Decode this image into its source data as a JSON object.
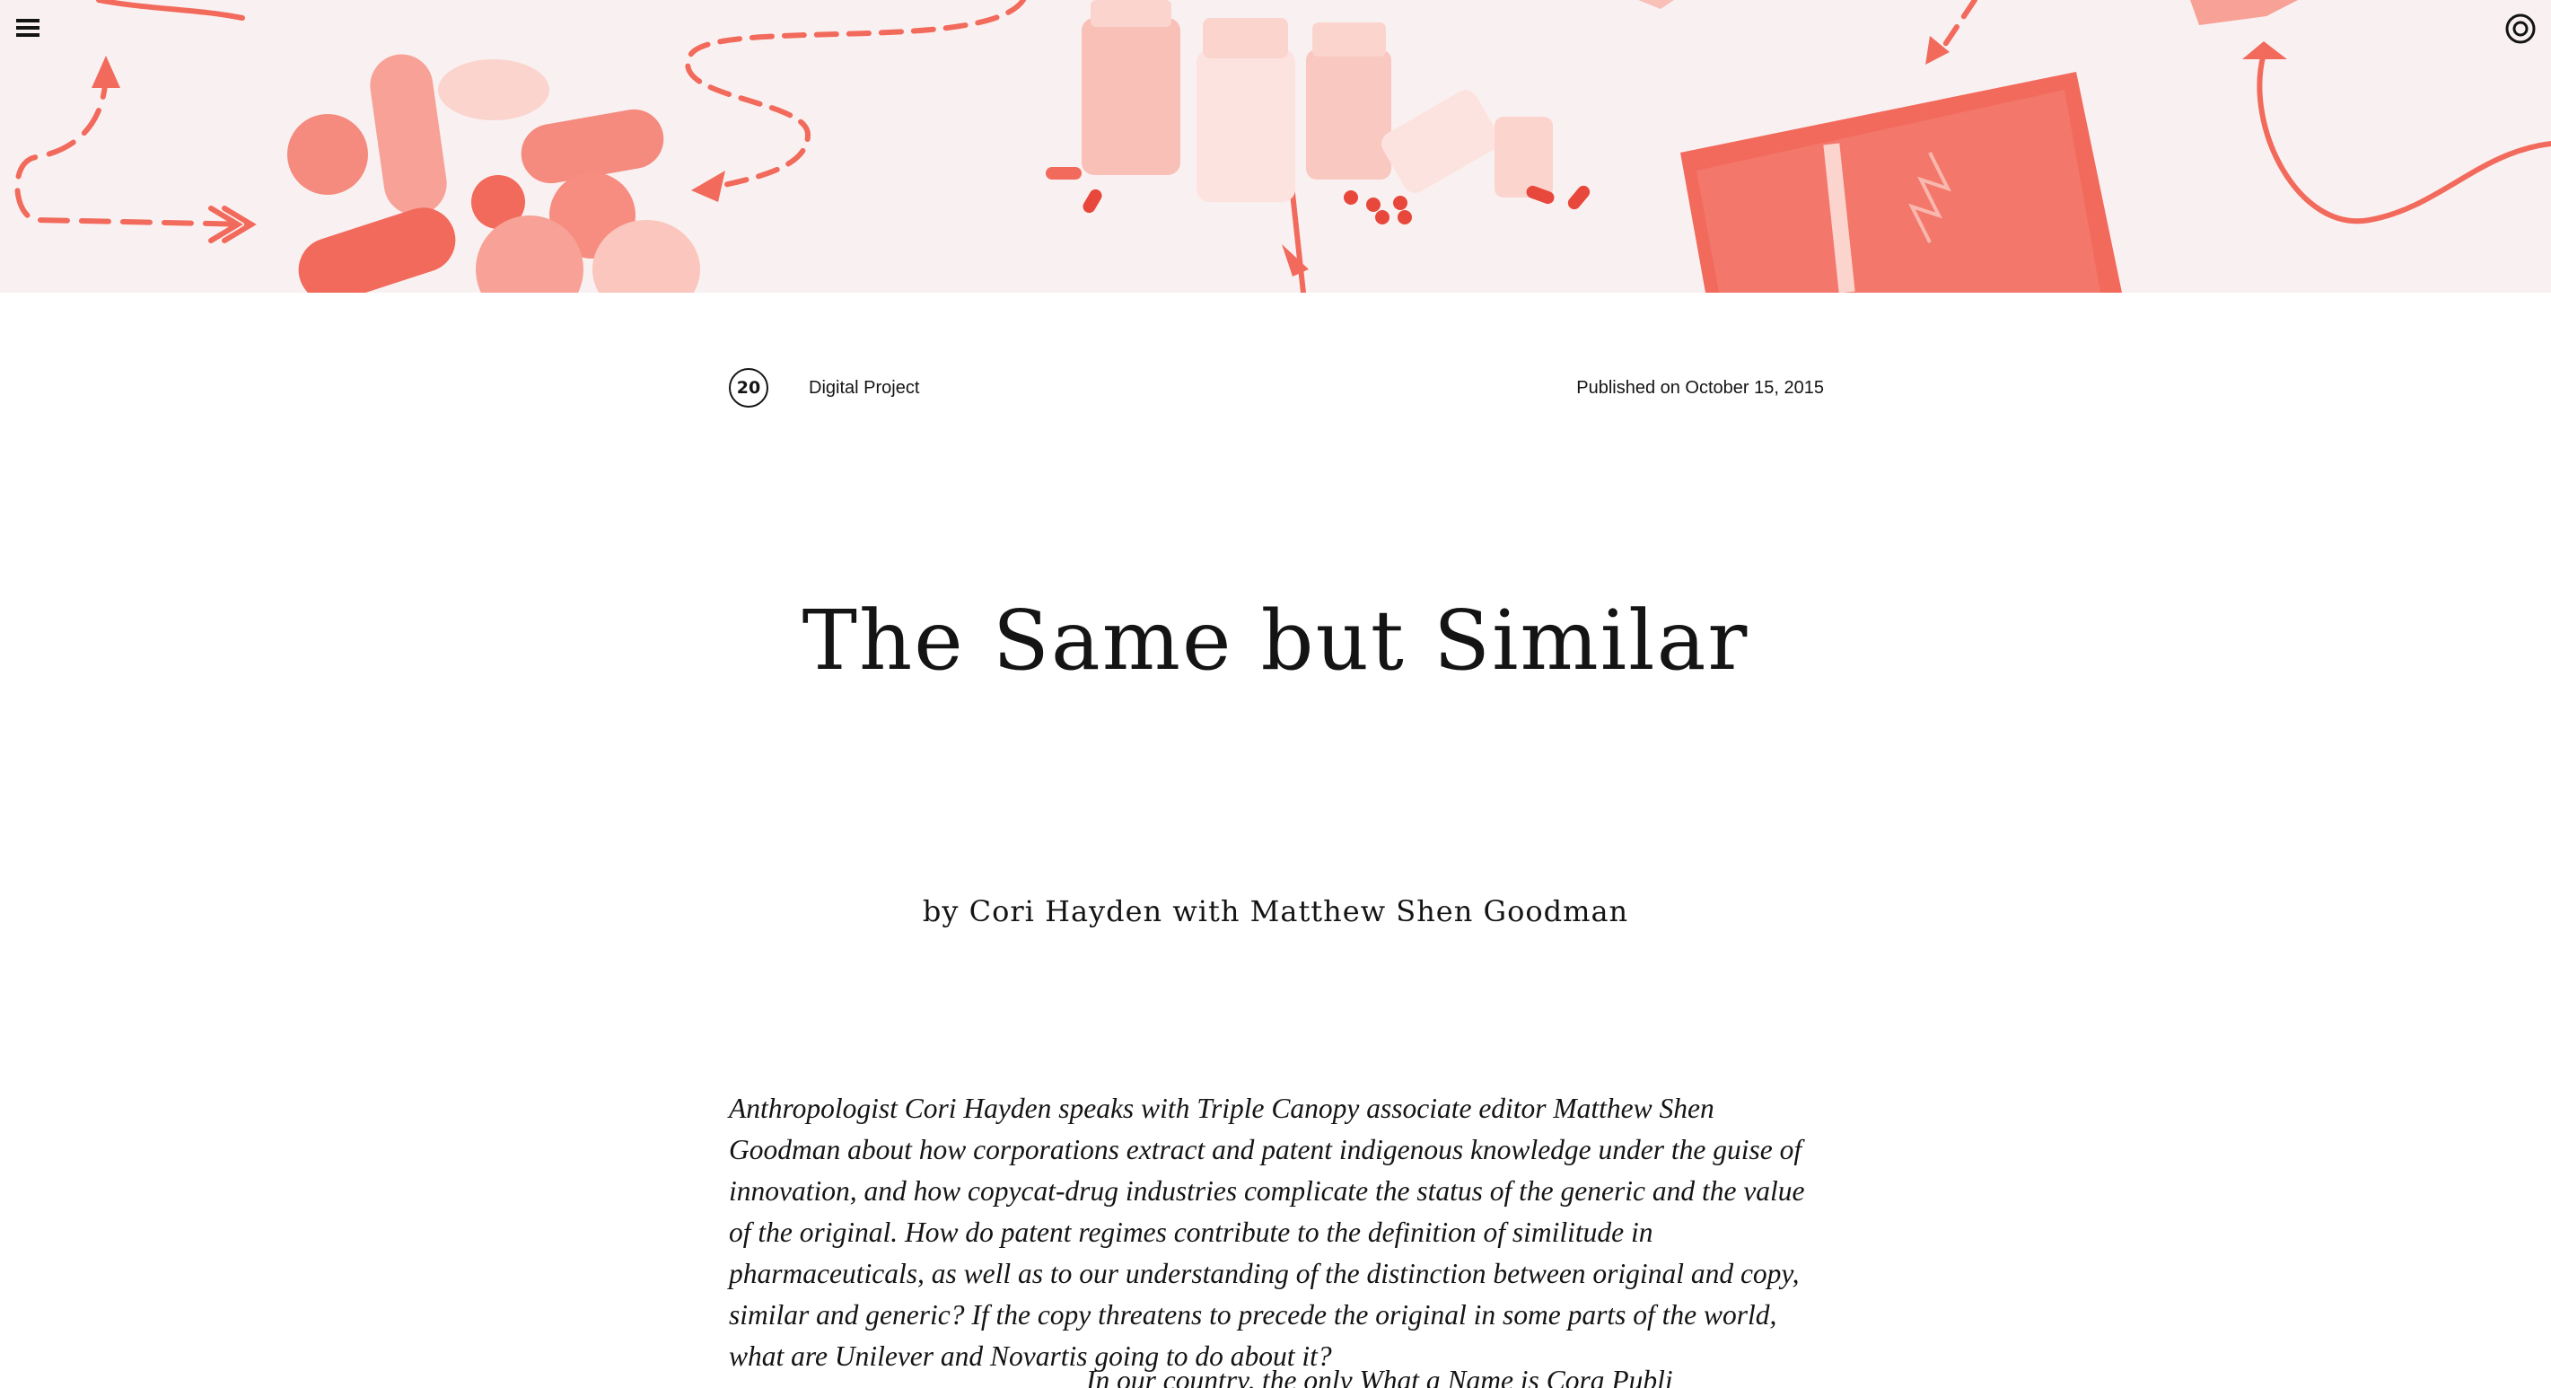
{
  "nav": {
    "menu_icon": "hamburger-menu-icon",
    "logo_icon": "circle-logo-icon"
  },
  "hero": {
    "accent_color": "#f26a5c",
    "background_color": "#f9f1f1"
  },
  "article": {
    "issue_number": "20",
    "section": "Digital Project",
    "published": "Published on October 15, 2015",
    "title": "The Same but Similar",
    "byline": {
      "prefix": "by",
      "author": "Cori Hayden",
      "joiner": "with",
      "coauthor": "Matthew Shen Goodman"
    },
    "deck": "Anthropologist Cori Hayden speaks with Triple Canopy associate editor Matthew Shen Goodman about how corporations extract and patent indigenous knowledge under the guise of innovation, and how copycat-drug industries complicate the status of the generic and the value of the original. How do patent regimes contribute to the definition of similitude in pharmaceuticals, as well as to our understanding of the distinction between original and copy, similar and generic? If the copy threatens to precede the original in some parts of the world, what are Unilever and Novartis going to do about it?",
    "next_line_partial": "In our country, the only What a Name is Cora Publi"
  }
}
